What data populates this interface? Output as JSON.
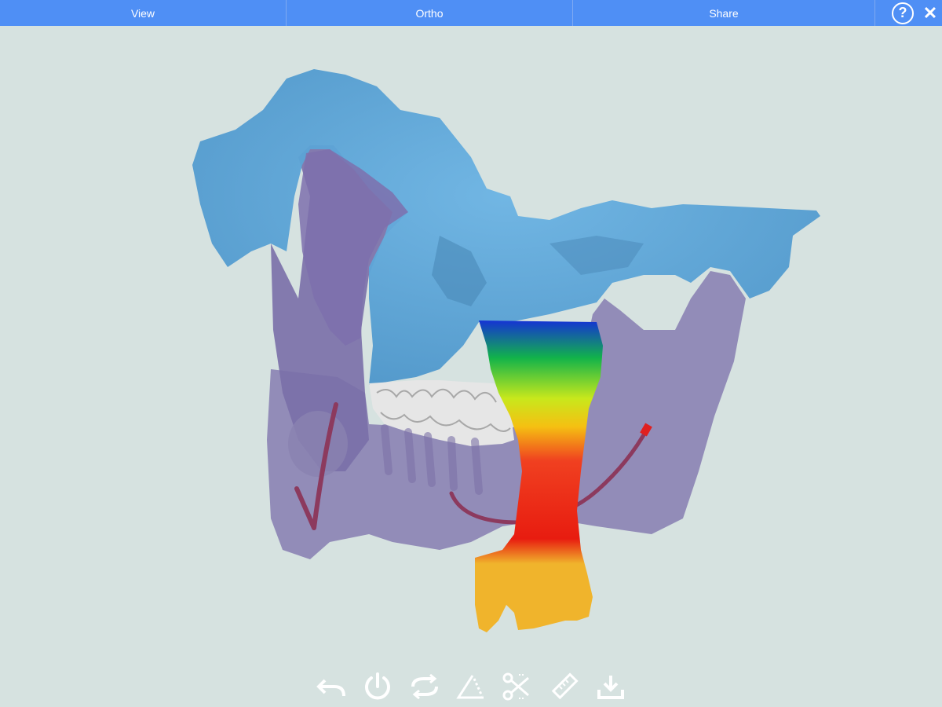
{
  "topbar": {
    "tabs": [
      {
        "label": "View"
      },
      {
        "label": "Ortho"
      },
      {
        "label": "Share"
      }
    ],
    "help_label": "?",
    "close_label": "✕"
  },
  "toolbar": {
    "tools": [
      {
        "icon": "undo-icon"
      },
      {
        "icon": "power-icon"
      },
      {
        "icon": "rotate-icon"
      },
      {
        "icon": "triangle-measure-icon"
      },
      {
        "icon": "scissors-icon"
      },
      {
        "icon": "ruler-icon"
      },
      {
        "icon": "download-icon"
      }
    ]
  },
  "colors": {
    "topbar": "#4f8ff5",
    "background": "#d6e2e0",
    "maxilla": "#5aa3d6",
    "mandible": "#8c84b4",
    "teeth": "#e8e8e8",
    "nerve": "#8c3a5e",
    "airway_gradient": [
      "#1533d4",
      "#12b34a",
      "#c8e81c",
      "#f5c012",
      "#f04020",
      "#e81c10",
      "#f0b42c"
    ]
  }
}
